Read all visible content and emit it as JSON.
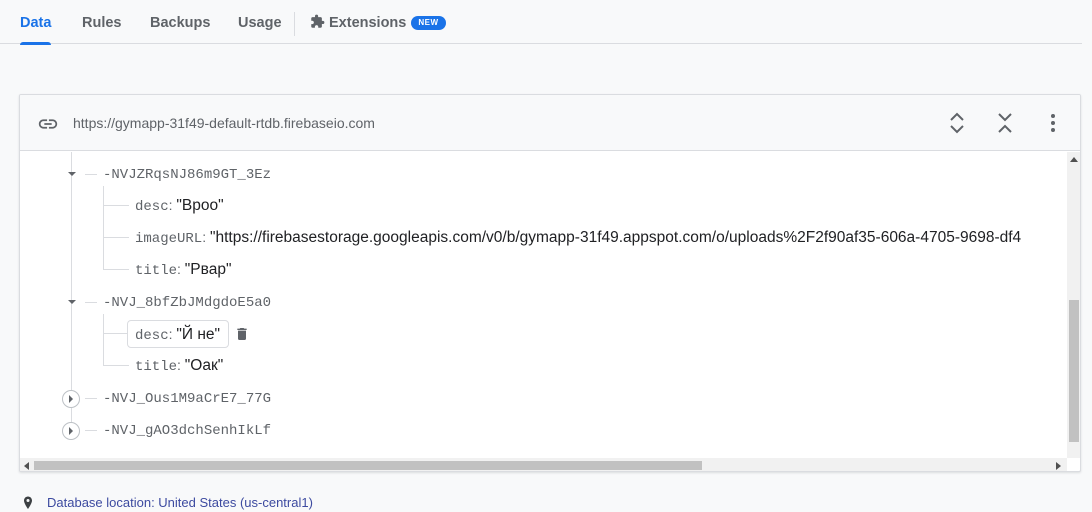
{
  "tabs": [
    {
      "label": "Data",
      "active": true
    },
    {
      "label": "Rules",
      "active": false
    },
    {
      "label": "Backups",
      "active": false
    },
    {
      "label": "Usage",
      "active": false
    }
  ],
  "extensions": {
    "label": "Extensions",
    "badge": "NEW",
    "icon": "puzzle-piece-icon"
  },
  "database": {
    "url": "https://gymapp-31f49-default-rtdb.firebaseio.com",
    "header_actions": [
      "expand-all-icon",
      "collapse-all-icon",
      "more-vert-icon"
    ]
  },
  "tree": {
    "node1": {
      "key": "-NVJZRqsNJ86m9GT_3Ez",
      "expanded": true,
      "children": [
        {
          "key": "desc",
          "value": "\"Врoo\""
        },
        {
          "key": "imageURL",
          "value": "\"https://firebasestorage.googleapis.com/v0/b/gymapp-31f49.appspot.com/o/uploads%2F2f90af35-606a-4705-9698-df4"
        },
        {
          "key": "title",
          "value": "\"Рвар\""
        }
      ]
    },
    "node2": {
      "key": "-NVJ_8bfZbJMdgdoE5a0",
      "expanded": true,
      "children": [
        {
          "key": "desc",
          "value": "\"Й не\""
        },
        {
          "key": "title",
          "value": "\"Оак\""
        }
      ]
    },
    "node3": {
      "key": "-NVJ_Ous1M9aCrE7_77G",
      "expanded": false
    },
    "node4": {
      "key": "-NVJ_gAO3dchSenhIkLf",
      "expanded": false
    }
  },
  "footer": {
    "text": "Database location: United States (us-central1)",
    "icon": "location-pin-icon"
  },
  "colors": {
    "accent": "#1a73e8",
    "text_secondary": "#5f6368",
    "border": "#dadce0"
  }
}
